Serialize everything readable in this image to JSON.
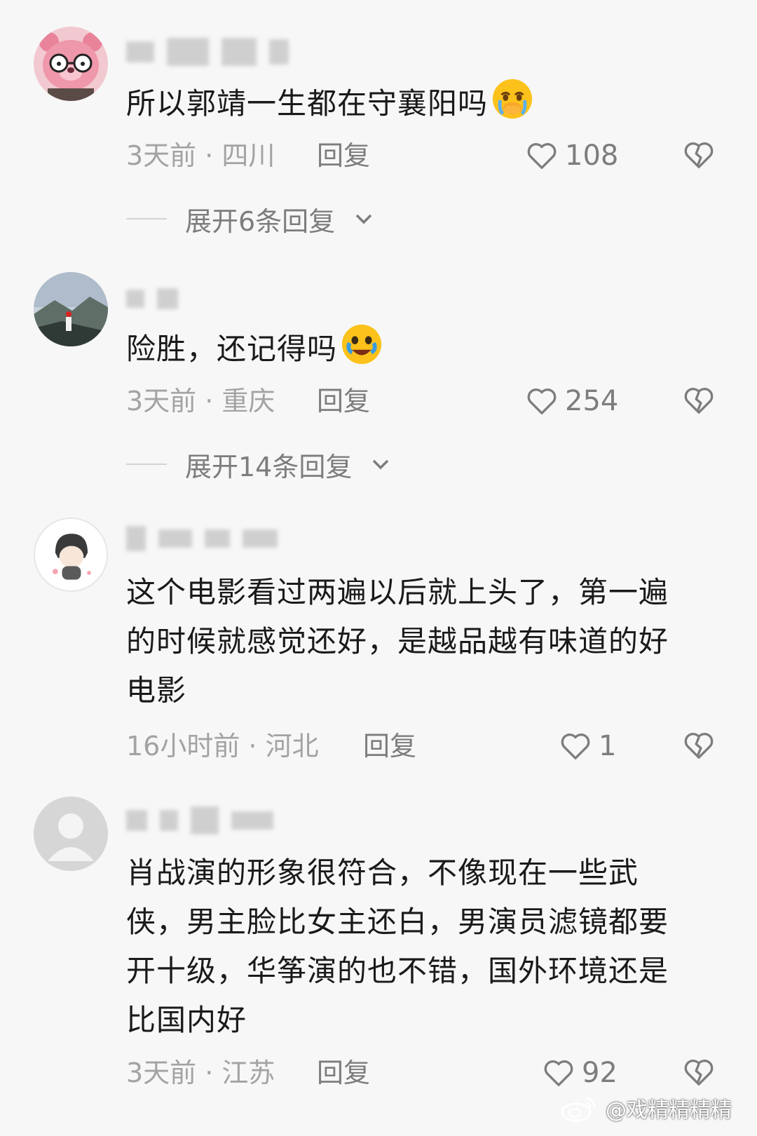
{
  "comments": [
    {
      "text": "所以郭靖一生都在守襄阳吗",
      "emoji": "crying-face-emoji",
      "meta": "3天前 · 四川",
      "reply": "回复",
      "likes": "108",
      "expand": "展开6条回复"
    },
    {
      "text": "险胜，还记得吗",
      "emoji": "tears-face-emoji",
      "meta": "3天前 · 重庆",
      "reply": "回复",
      "likes": "254",
      "expand": "展开14条回复"
    },
    {
      "text": "这个电影看过两遍以后就上头了，第一遍的时候就感觉还好，是越品越有味道的好电影",
      "meta": "16小时前 · 河北",
      "reply": "回复",
      "likes": "1"
    },
    {
      "text": "肖战演的形象很符合，不像现在一些武侠，男主脸比女主还白，男演员滤镜都要开十级，华筝演的也不错，国外环境还是比国内好",
      "meta": "3天前 · 江苏",
      "reply": "回复",
      "likes": "92"
    }
  ],
  "watermark": "@戏精精精精",
  "colors": {
    "background": "#f7f7f7",
    "text": "#1a1a1a",
    "meta": "#a3a3a3",
    "action": "#7d7d7d"
  }
}
